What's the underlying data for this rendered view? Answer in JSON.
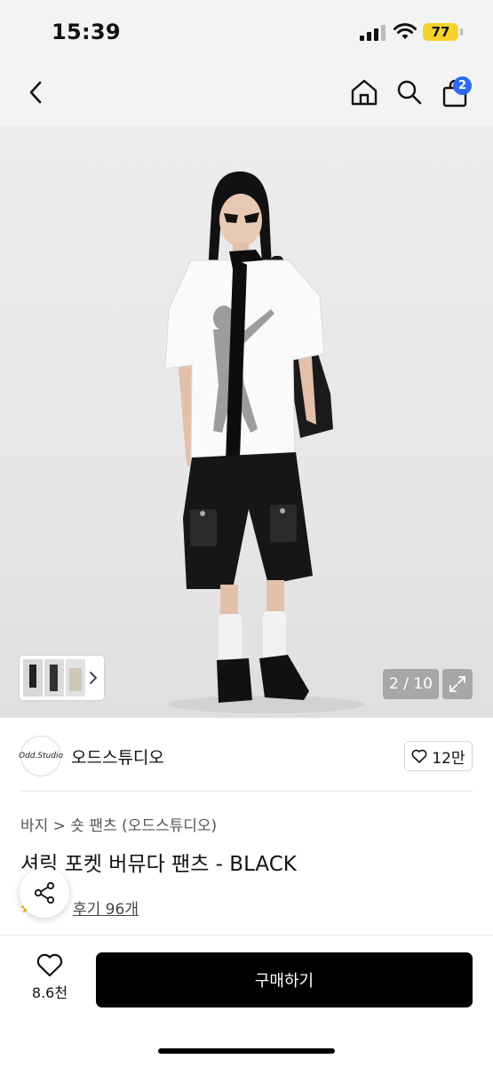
{
  "status_bar": {
    "time": "15:39",
    "battery": "77"
  },
  "nav": {
    "cart_count": "2"
  },
  "gallery": {
    "counter": "2 / 10"
  },
  "brand": {
    "logo_text": "Odd.Studio",
    "name": "오드스튜디오",
    "likes": "12만"
  },
  "product": {
    "breadcrumb": "바지 > 숏 팬츠 (오드스튜디오)",
    "title": "셔링 포켓 버뮤다 팬츠 - BLACK",
    "reviews": "후기 96개"
  },
  "bottom_bar": {
    "wish_count": "8.6천",
    "buy_label": "구매하기"
  },
  "colors": {
    "accent_badge": "#2f6af0",
    "battery": "#f6d22f",
    "buy_button": "#000000"
  }
}
